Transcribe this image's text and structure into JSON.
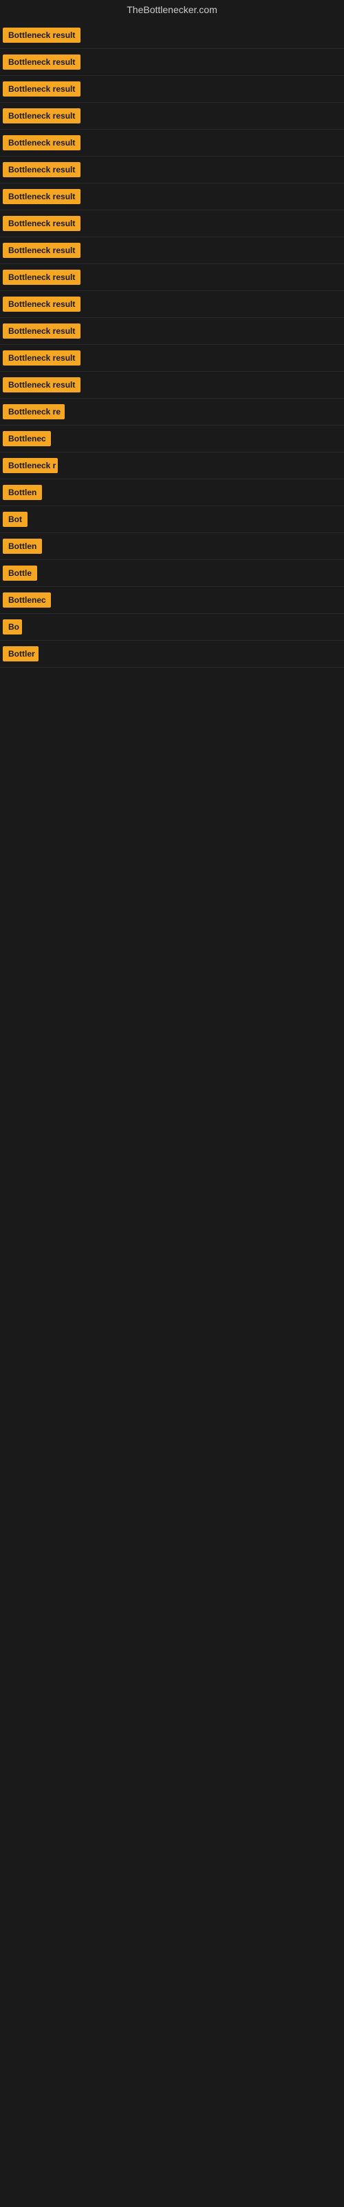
{
  "site": {
    "title": "TheBottlenecker.com"
  },
  "items": [
    {
      "id": 1,
      "label": "Bottleneck result",
      "width": 120
    },
    {
      "id": 2,
      "label": "Bottleneck result",
      "width": 120
    },
    {
      "id": 3,
      "label": "Bottleneck result",
      "width": 120
    },
    {
      "id": 4,
      "label": "Bottleneck result",
      "width": 120
    },
    {
      "id": 5,
      "label": "Bottleneck result",
      "width": 120
    },
    {
      "id": 6,
      "label": "Bottleneck result",
      "width": 120
    },
    {
      "id": 7,
      "label": "Bottleneck result",
      "width": 120
    },
    {
      "id": 8,
      "label": "Bottleneck result",
      "width": 120
    },
    {
      "id": 9,
      "label": "Bottleneck result",
      "width": 120
    },
    {
      "id": 10,
      "label": "Bottleneck result",
      "width": 120
    },
    {
      "id": 11,
      "label": "Bottleneck result",
      "width": 120
    },
    {
      "id": 12,
      "label": "Bottleneck result",
      "width": 120
    },
    {
      "id": 13,
      "label": "Bottleneck result",
      "width": 120
    },
    {
      "id": 14,
      "label": "Bottleneck result",
      "width": 120
    },
    {
      "id": 15,
      "label": "Bottleneck re",
      "width": 90
    },
    {
      "id": 16,
      "label": "Bottlenec",
      "width": 70
    },
    {
      "id": 17,
      "label": "Bottleneck r",
      "width": 80
    },
    {
      "id": 18,
      "label": "Bottlen",
      "width": 60
    },
    {
      "id": 19,
      "label": "Bot",
      "width": 36
    },
    {
      "id": 20,
      "label": "Bottlen",
      "width": 60
    },
    {
      "id": 21,
      "label": "Bottle",
      "width": 50
    },
    {
      "id": 22,
      "label": "Bottlenec",
      "width": 70
    },
    {
      "id": 23,
      "label": "Bo",
      "width": 28
    },
    {
      "id": 24,
      "label": "Bottler",
      "width": 52
    }
  ]
}
